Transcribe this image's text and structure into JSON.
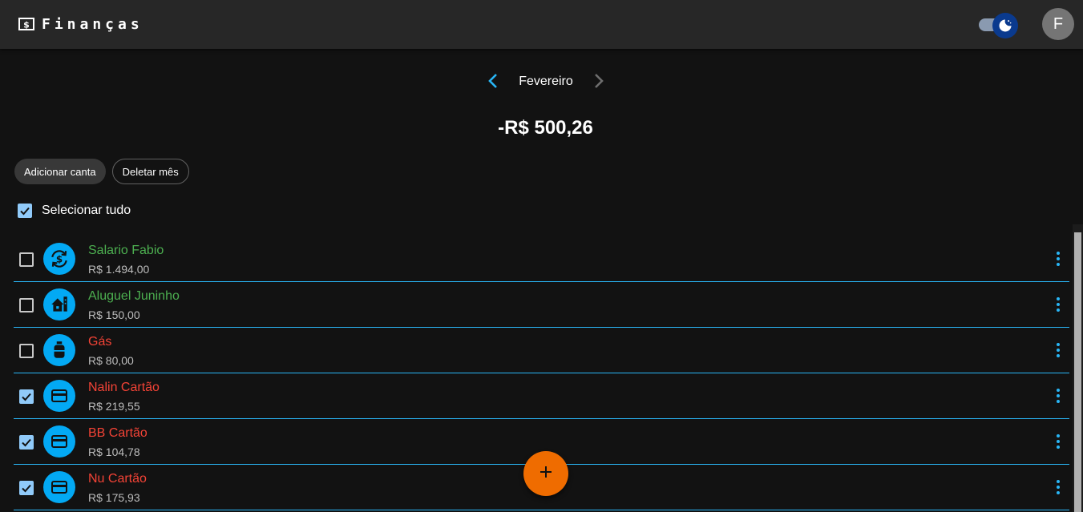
{
  "app": {
    "title": "Finanças",
    "icon": "money-icon",
    "theme_toggle": {
      "icon": "dark-mode-icon",
      "dark_mode": true
    },
    "avatar_initial": "F"
  },
  "month_nav": {
    "prev_icon": "chevron-left-icon",
    "month": "Fevereiro",
    "next_icon": "chevron-right-icon"
  },
  "total": "-R$ 500,26",
  "actions": {
    "add_label": "Adicionar canta",
    "delete_label": "Deletar mês"
  },
  "select_all": {
    "label": "Selecionar tudo",
    "checked": true
  },
  "accounts": [
    {
      "name": "Salario Fabio",
      "amount": "R$ 1.494,00",
      "type": "income",
      "icon": "currency-exchange-icon",
      "checked": false
    },
    {
      "name": "Aluguel Juninho",
      "amount": "R$ 150,00",
      "type": "income",
      "icon": "house-icon",
      "checked": false
    },
    {
      "name": "Gás",
      "amount": "R$ 80,00",
      "type": "expense",
      "icon": "gas-cylinder-icon",
      "checked": false
    },
    {
      "name": "Nalin Cartão",
      "amount": "R$ 219,55",
      "type": "expense",
      "icon": "credit-card-icon",
      "checked": true
    },
    {
      "name": "BB Cartão",
      "amount": "R$ 104,78",
      "type": "expense",
      "icon": "credit-card-icon",
      "checked": true
    },
    {
      "name": "Nu Cartão",
      "amount": "R$ 175,93",
      "type": "expense",
      "icon": "credit-card-icon",
      "checked": true
    }
  ],
  "fab_icon": "plus-icon",
  "colors": {
    "background": "#121212",
    "appbar": "#272727",
    "accent": "#03a9f4",
    "income": "#4caf50",
    "expense": "#f44336",
    "fab": "#ef6c00",
    "checkbox": "#90caf9"
  }
}
